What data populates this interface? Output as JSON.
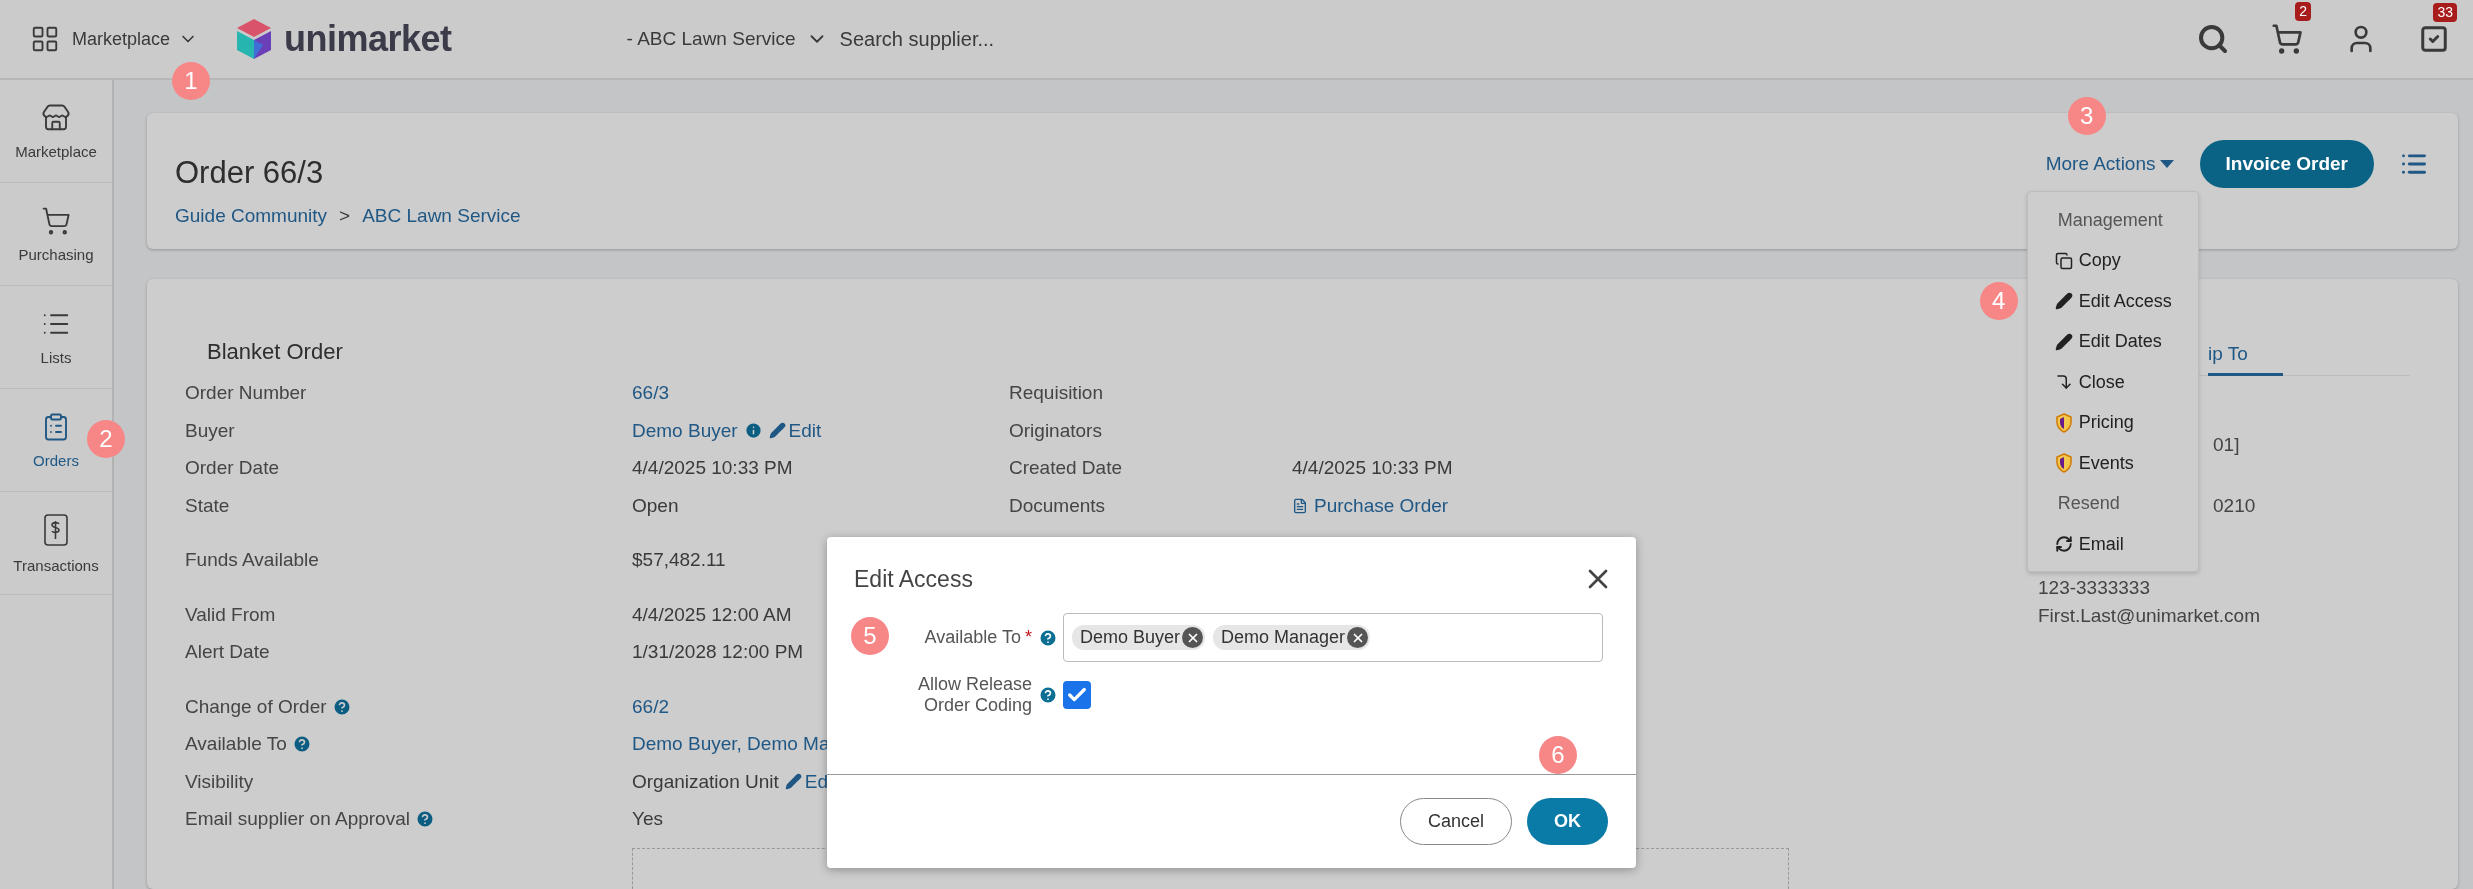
{
  "topbar": {
    "app_menu": {
      "label": "Marketplace",
      "marker": "1"
    },
    "logo": "unimarket",
    "supplier": "- ABC Lawn Service",
    "search": {
      "placeholder": "Search supplier..."
    },
    "cart_badge": "2",
    "tasks_badge": "33"
  },
  "sidebar": {
    "items": [
      {
        "label": "Marketplace",
        "selected": false
      },
      {
        "label": "Purchasing",
        "selected": false
      },
      {
        "label": "Lists",
        "selected": false
      },
      {
        "label": "Orders",
        "selected": true,
        "marker": "2"
      },
      {
        "label": "Transactions",
        "selected": false
      }
    ]
  },
  "header": {
    "title": "Order 66/3",
    "breadcrumb": [
      "Guide Community",
      "ABC Lawn Service"
    ],
    "breadcrumb_separator": ">",
    "more_actions": {
      "label": "More Actions",
      "marker": "3"
    },
    "primary_button": "Invoice Order"
  },
  "actions_menu": {
    "items": [
      {
        "kind": "heading",
        "label": "Management"
      },
      {
        "kind": "action",
        "label": "Copy"
      },
      {
        "kind": "action",
        "label": "Edit Access",
        "marker": "4"
      },
      {
        "kind": "action",
        "label": "Edit Dates"
      },
      {
        "kind": "action",
        "label": "Close"
      },
      {
        "kind": "action",
        "label": "Pricing"
      },
      {
        "kind": "action",
        "label": "Events"
      },
      {
        "kind": "heading",
        "label": "Resend"
      },
      {
        "kind": "action",
        "label": "Email"
      }
    ]
  },
  "details": {
    "title": "Blanket Order",
    "sections": [
      [
        {
          "label": "Order Number",
          "value": {
            "text": "66/3",
            "link": true
          },
          "label2": "Requisition"
        },
        {
          "label": "Buyer",
          "value": {
            "text": "Demo Buyer",
            "link": true,
            "info": true,
            "edit": "Edit"
          },
          "label2": "Originators"
        },
        {
          "label": "Order Date",
          "value": {
            "text": "4/4/2025 10:33 PM"
          },
          "label2": "Created Date",
          "value2": {
            "text": "4/4/2025 10:33 PM"
          }
        },
        {
          "label": "State",
          "value": {
            "text": "Open"
          },
          "label2": "Documents",
          "value2": {
            "text": "Purchase Order",
            "link": true,
            "doc": true
          }
        }
      ],
      [
        {
          "label": "Funds Available",
          "value": {
            "text": "$57,482.11"
          }
        }
      ],
      [
        {
          "label": "Valid From",
          "value": {
            "text": "4/4/2025 12:00 AM"
          }
        },
        {
          "label": "Alert Date",
          "value": {
            "text": "1/31/2028 12:00 PM"
          }
        }
      ],
      [
        {
          "label": "Change of Order",
          "help": true,
          "value": {
            "text": "66/2",
            "link": true
          }
        },
        {
          "label": "Available To",
          "help": true,
          "value": {
            "text": "Demo Buyer, Demo Ma",
            "link": true
          }
        },
        {
          "label": "Visibility",
          "value": {
            "text": "Organization Unit",
            "edit": "Ed"
          }
        },
        {
          "label": "Email supplier on Approval",
          "help": true,
          "value": {
            "text": "Yes"
          }
        }
      ]
    ],
    "ship_to": {
      "tab": "ip To",
      "lines": [
        "01]",
        "0210",
        "123-3333333",
        "First.Last@unimarket.com"
      ]
    }
  },
  "dialog": {
    "title": "Edit Access",
    "fields": [
      {
        "kind": "tags",
        "label": "Available To",
        "required_mark": "*",
        "help": true,
        "marker": "5",
        "tags": [
          "Demo Buyer",
          "Demo Manager"
        ]
      },
      {
        "kind": "checkbox",
        "label": "Allow Release Order Coding",
        "help": true,
        "checked": true
      }
    ],
    "buttons": [
      {
        "label": "Cancel",
        "kind": "secondary"
      },
      {
        "label": "OK",
        "kind": "primary",
        "marker": "6"
      }
    ]
  }
}
